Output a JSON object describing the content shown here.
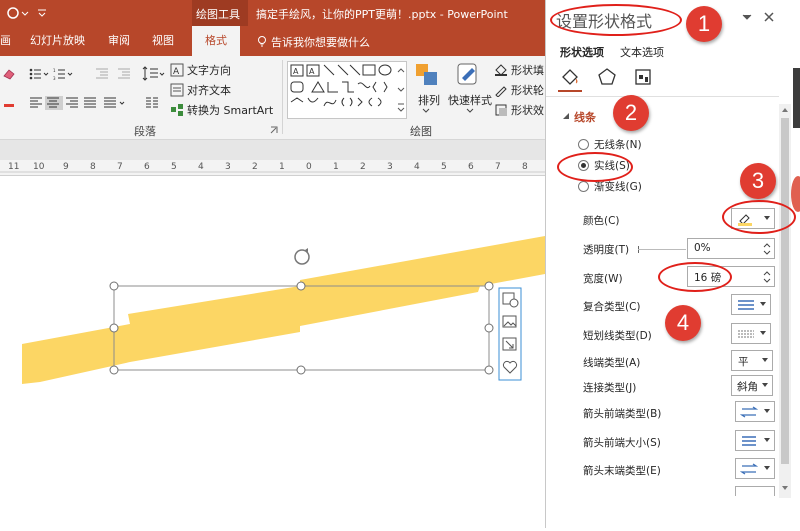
{
  "title_bar": {
    "drawing_tools": "绘图工具",
    "filename": "搞定手绘风，让你的PPT更萌！.pptx - PowerPoint"
  },
  "tabs": [
    "画",
    "幻灯片放映",
    "审阅",
    "视图",
    "格式"
  ],
  "tell_me": "告诉我你想要做什么",
  "ribbon": {
    "text_direction": "文字方向",
    "align_text": "对齐文本",
    "convert_smartart": "转换为 SmartArt",
    "paragraph_group": "段落",
    "drawing_group": "绘图",
    "arrange": "排列",
    "quick_styles": "快速样式",
    "shape_fill": "形状填",
    "shape_outline": "形状轮",
    "shape_effects": "形状效"
  },
  "ruler": {
    "ticks": [
      "11",
      "10",
      "9",
      "8",
      "7",
      "6",
      "5",
      "4",
      "3",
      "2",
      "1",
      "0",
      "1",
      "2",
      "3",
      "4",
      "5",
      "6",
      "7",
      "8"
    ]
  },
  "pane": {
    "title": "设置形状格式",
    "tab_shape": "形状选项",
    "tab_text": "文本选项",
    "section": "线条",
    "radio_none": "无线条(N)",
    "radio_solid": "实线(S)",
    "radio_gradient": "渐变线(G)",
    "color": "颜色(C)",
    "transparency": "透明度(T)",
    "transparency_value": "0%",
    "width": "宽度(W)",
    "width_value": "16 磅",
    "compound": "复合类型(C)",
    "dash": "短划线类型(D)",
    "cap": "线端类型(A)",
    "cap_value": "平",
    "join": "连接类型(J)",
    "join_value": "斜角",
    "arrow_begin_type": "箭头前端类型(B)",
    "arrow_begin_size": "箭头前端大小(S)",
    "arrow_end_type": "箭头末端类型(E)"
  },
  "annotations": [
    "1",
    "2",
    "3",
    "4"
  ],
  "colors": {
    "accent": "#b7472a",
    "shape_fill": "#fcd664",
    "annotation": "#e03c31"
  }
}
